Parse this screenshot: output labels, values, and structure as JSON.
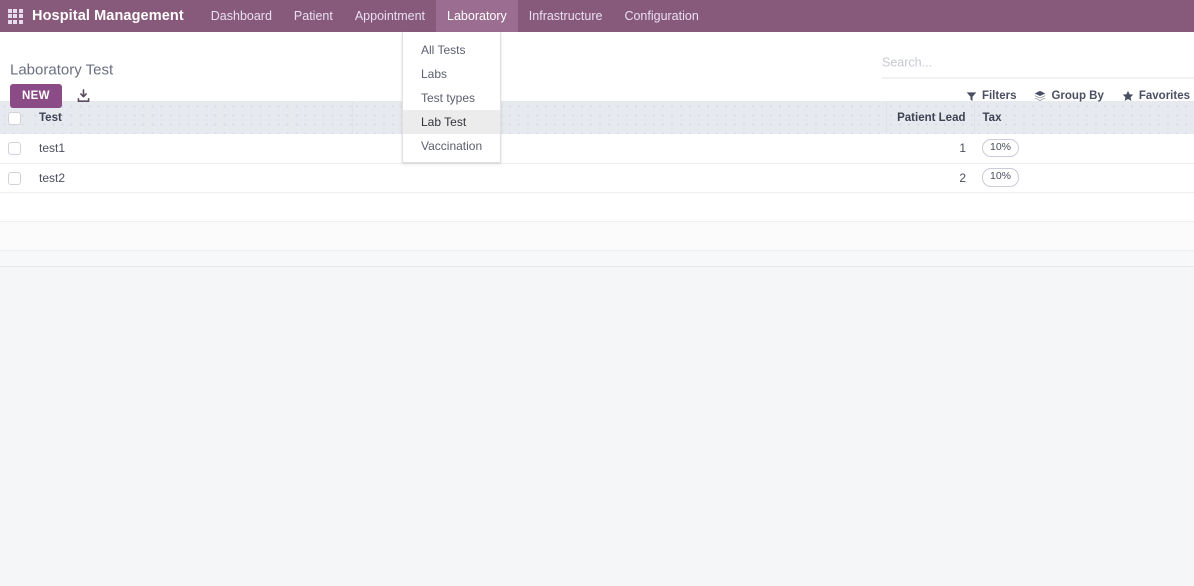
{
  "navbar": {
    "apps_icon": "grid-apps-icon",
    "brand": "Hospital Management",
    "items": [
      {
        "label": "Dashboard",
        "active": false
      },
      {
        "label": "Patient",
        "active": false
      },
      {
        "label": "Appointment",
        "active": false
      },
      {
        "label": "Laboratory",
        "active": true
      },
      {
        "label": "Infrastructure",
        "active": false
      },
      {
        "label": "Configuration",
        "active": false
      }
    ],
    "brand_color": "#875A7B",
    "active_item_color": "#9B6D90"
  },
  "dropdown": {
    "owner": "Laboratory",
    "items": [
      {
        "label": "All Tests",
        "active": false
      },
      {
        "label": "Labs",
        "active": false
      },
      {
        "label": "Test types",
        "active": false
      },
      {
        "label": "Lab Test",
        "active": true
      },
      {
        "label": "Vaccination",
        "active": false
      }
    ]
  },
  "control_panel": {
    "title": "Laboratory Test",
    "new_label": "NEW",
    "import_icon": "download-import-icon",
    "accent_color": "#8a4b86"
  },
  "search": {
    "placeholder": "Search...",
    "value": ""
  },
  "search_buttons": [
    {
      "label": "Filters",
      "icon": "funnel-icon"
    },
    {
      "label": "Group By",
      "icon": "layers-icon"
    },
    {
      "label": "Favorites",
      "icon": "star-icon"
    }
  ],
  "list": {
    "columns": [
      {
        "label": "",
        "key": "select",
        "align": "left"
      },
      {
        "label": "Test",
        "key": "test",
        "align": "left"
      },
      {
        "label": "",
        "key": "spacer",
        "align": "left"
      },
      {
        "label": "Patient Lead",
        "key": "patient_lead",
        "align": "right"
      },
      {
        "label": "Tax",
        "key": "tax",
        "align": "left"
      }
    ],
    "rows": [
      {
        "test": "test1",
        "patient_lead": "1",
        "tax": "10%"
      },
      {
        "test": "test2",
        "patient_lead": "2",
        "tax": "10%"
      }
    ],
    "empty_row_count": 2
  }
}
